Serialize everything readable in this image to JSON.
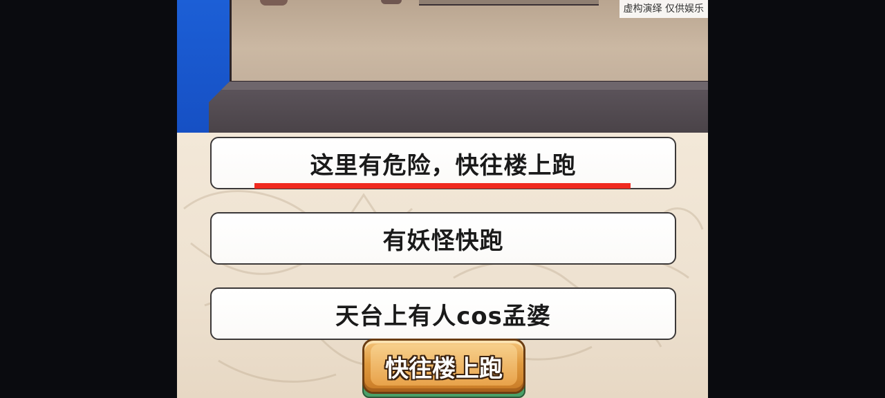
{
  "watermark": "虚构演绎 仅供娱乐",
  "options": [
    {
      "label": "这里有危险，快往楼上跑",
      "underlined": true
    },
    {
      "label": "有妖怪快跑",
      "underlined": false
    },
    {
      "label": "天台上有人cos孟婆",
      "underlined": false
    }
  ],
  "action_button": {
    "label": "快往楼上跑"
  },
  "colors": {
    "highlight_underline": "#f02a1f",
    "wall_blue": "#1c5fd6",
    "button_orange": "#e09a3e",
    "panel_bg": "#f3e8d8"
  }
}
